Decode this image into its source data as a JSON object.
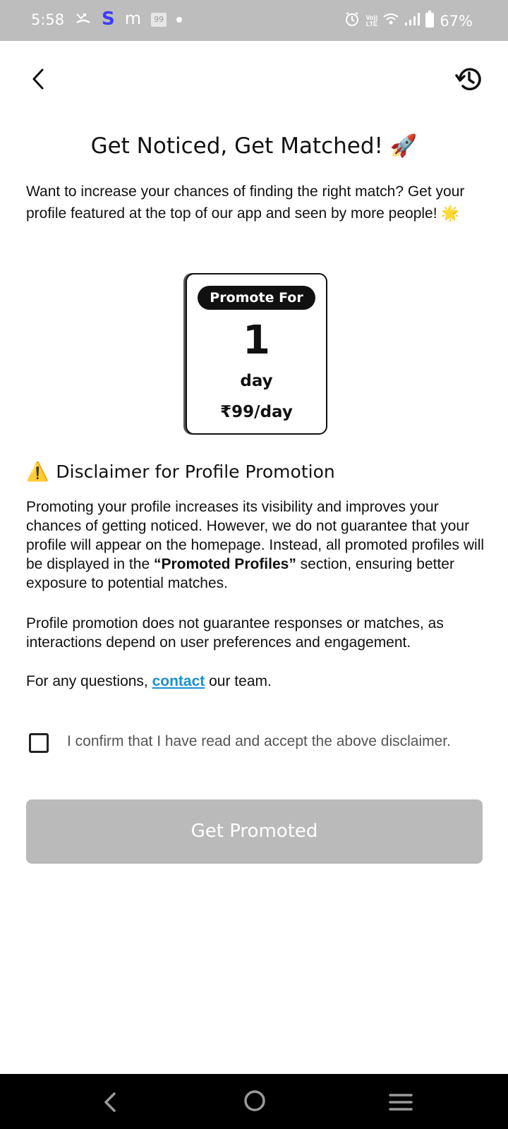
{
  "status_bar": {
    "time": "5:58",
    "battery": "67%",
    "icons": [
      "missed-call-icon",
      "s-app-icon",
      "m-app-icon",
      "app-99-icon",
      "notification-dot-icon",
      "alarm-icon",
      "volte-icon",
      "wifi-icon",
      "signal-icon",
      "battery-icon"
    ],
    "s_glyph": "S",
    "m_glyph": "m",
    "badge_99": "99",
    "lte_top": "Vo))",
    "lte_bottom": "LTE",
    "s_color": "#3d3dff"
  },
  "header": {
    "back_icon": "chevron-left-icon",
    "history_icon": "history-icon"
  },
  "title": "Get Noticed, Get Matched! 🚀",
  "intro": "Want to increase your chances of finding the right match? Get your profile featured at the top of our app and seen by more people! 🌟",
  "promo_card": {
    "label": "Promote For",
    "count": "1",
    "unit": "day",
    "price": "₹99/day"
  },
  "disclaimer": {
    "icon": "⚠️",
    "title": "Disclaimer for Profile Promotion",
    "p1_before": "Promoting your profile increases its visibility and improves your chances of getting noticed. However, we do not guarantee that your profile will appear on the homepage. Instead, all promoted profiles will be displayed in the ",
    "p1_bold": "“Promoted Profiles”",
    "p1_after": " section, ensuring better exposure to potential matches.",
    "p2": "Profile promotion does not guarantee responses or matches, as interactions depend on user preferences and engagement.",
    "p3_before": "For any questions, ",
    "p3_link": "contact",
    "p3_after": " our team."
  },
  "confirm": {
    "text": "I confirm that I have read and accept the above disclaimer.",
    "checked": false
  },
  "button": {
    "label": "Get Promoted",
    "color": "#bababa"
  },
  "colors": {
    "status_bar": "#bdbdbd",
    "link": "#1a8fd8",
    "nav_bar": "#000000"
  },
  "nav_bar": {
    "icons": [
      "nav-back-icon",
      "nav-home-icon",
      "nav-recents-icon"
    ]
  }
}
